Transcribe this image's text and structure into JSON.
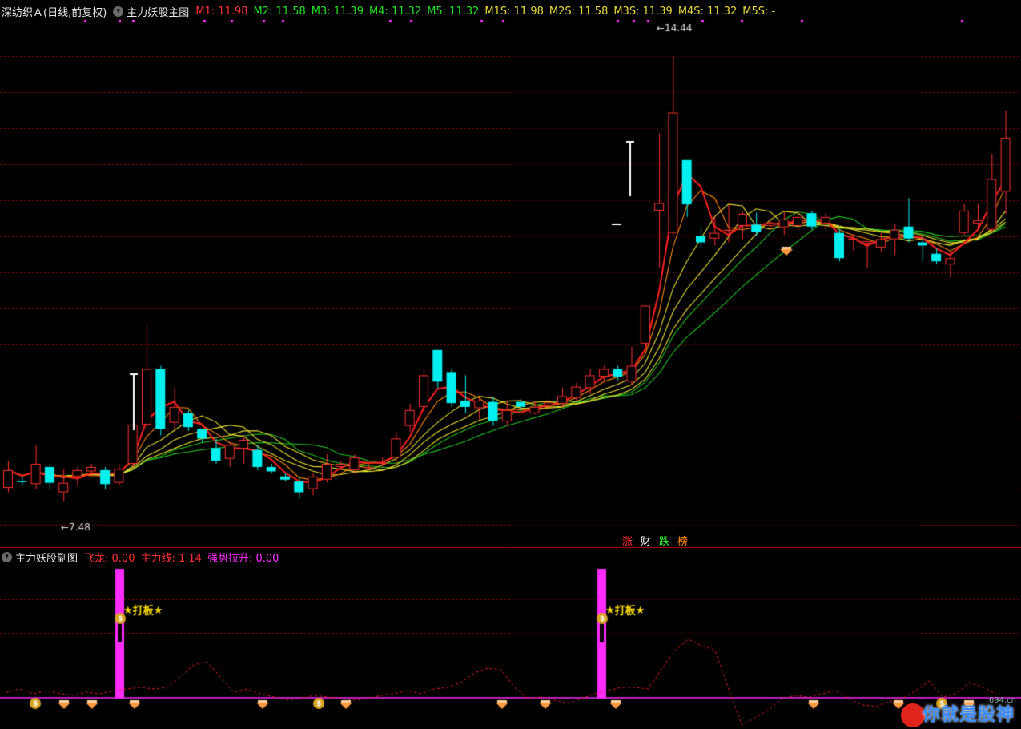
{
  "main": {
    "stock": "深纺织Ａ",
    "period": "(日线,前复权)",
    "indicator": "主力妖股主图",
    "ma_labels": [
      {
        "text": "M1: 11.98",
        "color": "red"
      },
      {
        "text": "M2: 11.58",
        "color": "green"
      },
      {
        "text": "M3: 11.39",
        "color": "green"
      },
      {
        "text": "M4: 11.32",
        "color": "green"
      },
      {
        "text": "M5: 11.32",
        "color": "green"
      },
      {
        "text": "M1S: 11.98",
        "color": "yel"
      },
      {
        "text": "M2S: 11.58",
        "color": "yel"
      },
      {
        "text": "M3S: 11.39",
        "color": "yel"
      },
      {
        "text": "M4S: 11.32",
        "color": "yel"
      },
      {
        "text": "M5S: -",
        "color": "yel"
      }
    ],
    "high_label": "14.44",
    "low_label": "7.48",
    "tags": [
      "涨",
      "财",
      "跌",
      "榜"
    ]
  },
  "sub": {
    "indicator": "主力妖股副图",
    "items": [
      {
        "text": "飞龙: 0.00",
        "color": "red"
      },
      {
        "text": "主力线: 1.14",
        "color": "red"
      },
      {
        "text": "强势拉升: 0.00",
        "color": "mag"
      }
    ],
    "signal_label": "★打板★"
  },
  "colors": {
    "up": "#ff3030",
    "down": "#00f0f0",
    "ma_main": "#ff2020",
    "ma_fast": "#ff8c00",
    "ma_yellow": "#e8e030",
    "ma_green": "#20c020",
    "grid": "#8b0000",
    "magenta": "#ff2cff",
    "tags": [
      "#ff3030",
      "#ffffff",
      "#30ff30",
      "#ff8c00"
    ]
  },
  "watermark": "你就是股神",
  "site": "694.cn",
  "chart_data": {
    "type": "candlestick",
    "ylim": [
      7.0,
      15.0
    ],
    "candles": [
      [
        7.62,
        7.9,
        7.55,
        8.05
      ],
      [
        7.73,
        7.72,
        7.65,
        7.8
      ],
      [
        7.68,
        8.0,
        7.6,
        8.3
      ],
      [
        7.95,
        7.7,
        7.6,
        8.0
      ],
      [
        7.55,
        7.7,
        7.4,
        7.92
      ],
      [
        7.8,
        7.9,
        7.65,
        7.95
      ],
      [
        7.88,
        7.95,
        7.8,
        8.0
      ],
      [
        7.9,
        7.68,
        7.6,
        7.95
      ],
      [
        7.7,
        7.92,
        7.65,
        8.0
      ],
      [
        8.0,
        8.62,
        7.95,
        8.62
      ],
      [
        8.62,
        9.5,
        8.55,
        10.2
      ],
      [
        9.5,
        8.55,
        8.45,
        9.55
      ],
      [
        8.65,
        8.9,
        8.55,
        9.2
      ],
      [
        8.8,
        8.58,
        8.52,
        8.85
      ],
      [
        8.55,
        8.4,
        8.33,
        8.55
      ],
      [
        8.25,
        8.05,
        8.0,
        8.4
      ],
      [
        8.08,
        8.3,
        7.95,
        8.35
      ],
      [
        8.24,
        8.38,
        8.0,
        8.45
      ],
      [
        8.22,
        7.95,
        7.9,
        8.3
      ],
      [
        7.95,
        7.88,
        7.85,
        8.0
      ],
      [
        7.8,
        7.75,
        7.72,
        7.85
      ],
      [
        7.72,
        7.55,
        7.45,
        7.78
      ],
      [
        7.6,
        7.8,
        7.5,
        7.85
      ],
      [
        7.75,
        8.0,
        7.7,
        8.15
      ],
      [
        7.95,
        8.0,
        7.9,
        8.05
      ],
      [
        7.9,
        8.1,
        7.85,
        8.15
      ],
      [
        7.95,
        7.95,
        7.9,
        8.0
      ],
      [
        8.0,
        8.02,
        7.95,
        8.1
      ],
      [
        8.1,
        8.4,
        8.0,
        8.5
      ],
      [
        8.6,
        8.85,
        8.5,
        8.95
      ],
      [
        8.9,
        9.4,
        8.8,
        9.5
      ],
      [
        9.8,
        9.3,
        9.2,
        9.8
      ],
      [
        9.45,
        8.96,
        8.9,
        9.5
      ],
      [
        9.0,
        8.9,
        8.8,
        9.4
      ],
      [
        8.88,
        9.0,
        8.7,
        9.05
      ],
      [
        8.98,
        8.68,
        8.6,
        9.06
      ],
      [
        8.67,
        8.85,
        8.6,
        9.0
      ],
      [
        8.98,
        8.9,
        8.85,
        9.03
      ],
      [
        8.8,
        8.9,
        8.78,
        9.0
      ],
      [
        8.92,
        8.97,
        8.9,
        9.02
      ],
      [
        8.95,
        9.07,
        8.9,
        9.2
      ],
      [
        9.04,
        9.22,
        9.0,
        9.28
      ],
      [
        9.2,
        9.4,
        9.1,
        9.5
      ],
      [
        9.38,
        9.5,
        9.3,
        9.55
      ],
      [
        9.5,
        9.38,
        9.32,
        9.55
      ],
      [
        9.3,
        9.55,
        9.25,
        9.85
      ],
      [
        9.9,
        10.5,
        9.8,
        10.5
      ],
      [
        12.0,
        12.12,
        11.1,
        13.22
      ],
      [
        11.65,
        13.55,
        11.6,
        14.44
      ],
      [
        12.8,
        12.1,
        11.9,
        12.5
      ],
      [
        11.6,
        11.5,
        11.4,
        11.75
      ],
      [
        11.56,
        11.65,
        11.45,
        11.9
      ],
      [
        11.7,
        11.7,
        11.5,
        12.1
      ],
      [
        11.76,
        11.95,
        11.55,
        11.98
      ],
      [
        11.78,
        11.66,
        11.6,
        11.97
      ],
      [
        11.76,
        11.8,
        11.7,
        11.85
      ],
      [
        11.74,
        11.86,
        11.62,
        11.98
      ],
      [
        11.76,
        11.9,
        11.7,
        12.0
      ],
      [
        11.96,
        11.75,
        11.7,
        12.0
      ],
      [
        11.8,
        11.9,
        11.7,
        11.96
      ],
      [
        11.65,
        11.25,
        11.2,
        11.7
      ],
      [
        11.55,
        11.56,
        11.37,
        11.63
      ],
      [
        11.48,
        11.52,
        11.1,
        11.52
      ],
      [
        11.42,
        11.55,
        11.35,
        11.65
      ],
      [
        11.55,
        11.7,
        11.3,
        11.8
      ],
      [
        11.75,
        11.56,
        11.5,
        12.2
      ],
      [
        11.5,
        11.45,
        11.2,
        11.6
      ],
      [
        11.32,
        11.2,
        11.15,
        11.4
      ],
      [
        11.15,
        11.25,
        10.95,
        11.36
      ],
      [
        11.65,
        12.0,
        11.62,
        12.1
      ],
      [
        11.8,
        11.85,
        11.7,
        12.1
      ],
      [
        11.7,
        12.5,
        11.65,
        12.9
      ],
      [
        12.3,
        13.15,
        11.95,
        13.58
      ]
    ]
  }
}
